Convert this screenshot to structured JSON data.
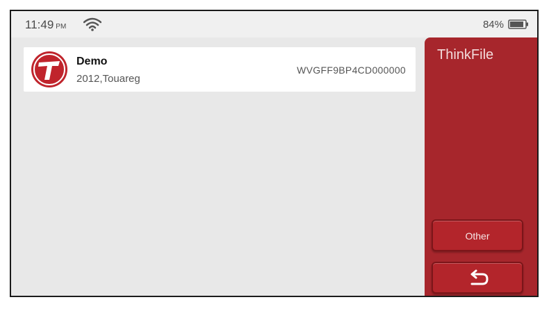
{
  "status_bar": {
    "time": "11:49",
    "ampm": "PM",
    "battery": "84%",
    "wifi_icon": "wifi-icon",
    "battery_icon": "battery-icon"
  },
  "vehicle_list": [
    {
      "name": "Demo",
      "details": "2012,Touareg",
      "vin": "WVGFF9BP4CD000000",
      "icon": "brand-logo-icon"
    }
  ],
  "sidebar": {
    "title": "ThinkFile",
    "other_label": "Other",
    "back_icon": "back-arrow-icon"
  },
  "colors": {
    "accent": "#a7262c",
    "background": "#e8e8e8",
    "card": "#ffffff"
  }
}
